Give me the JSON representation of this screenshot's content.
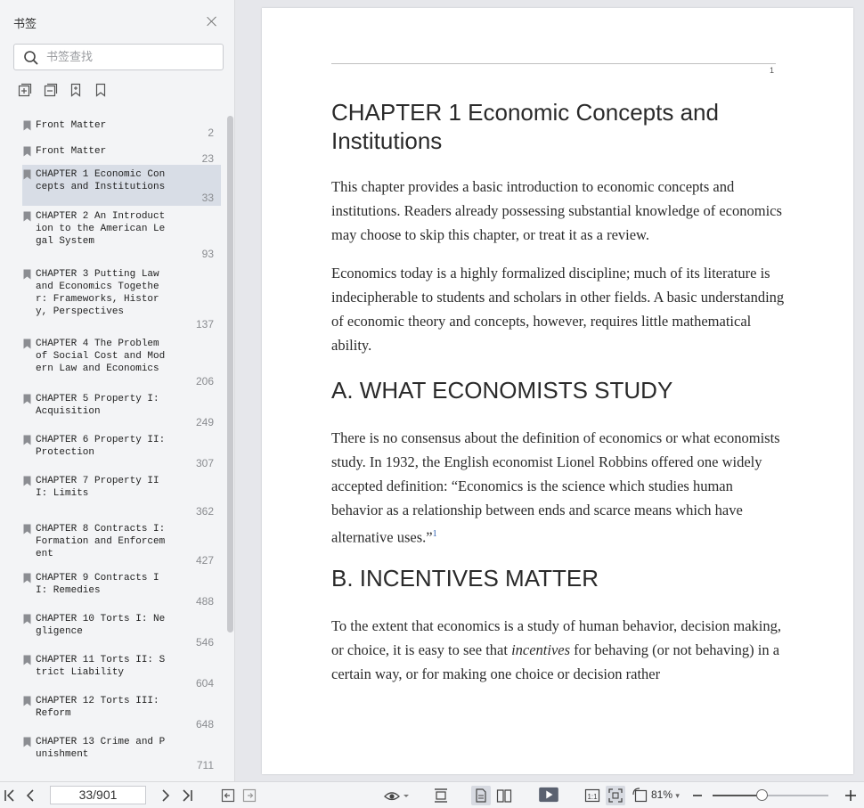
{
  "sidebar": {
    "title": "书签",
    "search_placeholder": "书签查找",
    "bookmarks": [
      {
        "label": "Front Matter",
        "page": "2"
      },
      {
        "label": "Front Matter",
        "page": "23"
      },
      {
        "label": "CHAPTER 1 Economic Concepts and Institutions",
        "page": "33",
        "selected": true
      },
      {
        "label": "CHAPTER 2 An Introduction to the American Legal System",
        "page": "93"
      },
      {
        "label": "CHAPTER 3 Putting Law and Economics Together: Frameworks, History, Perspectives",
        "page": "137"
      },
      {
        "label": "CHAPTER 4 The Problem of Social Cost and Modern Law and Economics",
        "page": "206"
      },
      {
        "label": "CHAPTER 5 Property I: Acquisition",
        "page": "249"
      },
      {
        "label": "CHAPTER 6 Property II: Protection",
        "page": "307"
      },
      {
        "label": "CHAPTER 7 Property III: Limits",
        "page": "362"
      },
      {
        "label": "CHAPTER 8 Contracts I: Formation and Enforcement",
        "page": "427"
      },
      {
        "label": "CHAPTER 9 Contracts II: Remedies",
        "page": "488"
      },
      {
        "label": "CHAPTER 10 Torts I: Negligence",
        "page": "546"
      },
      {
        "label": "CHAPTER 11 Torts II: Strict Liability",
        "page": "604"
      },
      {
        "label": "CHAPTER 12 Torts III: Reform",
        "page": "648"
      },
      {
        "label": "CHAPTER 13 Crime and Punishment",
        "page": "711"
      }
    ]
  },
  "document": {
    "header_page_number": "1",
    "chapter_title": "CHAPTER 1 Economic Concepts and Institutions",
    "para1": "This chapter provides a basic introduction to economic concepts and institutions. Readers already possessing substantial knowledge of economics may choose to skip this chapter, or treat it as a review.",
    "para2": "Economics today is a highly formalized discipline; much of its literature is indecipherable to students and scholars in other fields. A basic understanding of economic theory and concepts, however, requires little mathematical ability.",
    "section_a": "A. WHAT ECONOMISTS STUDY",
    "para3": "There is no consensus about the definition of economics or what economists study. In 1932, the English economist Lionel Robbins offered one widely accepted definition: “Economics is the science which studies human behavior as a relationship between ends and scarce means which have alternative uses.”",
    "para3_footnote": "1",
    "section_b": "B. INCENTIVES MATTER",
    "para4_a": "To the extent that economics is a study of human behavior, decision making, or choice, it is easy to see that ",
    "para4_em": "incentives",
    "para4_b": " for behaving (or not behaving) in a certain way, or for making one choice or decision rather"
  },
  "toolbar": {
    "page_indicator": "33/901",
    "zoom": "81%",
    "zoom_level": 0.43
  }
}
